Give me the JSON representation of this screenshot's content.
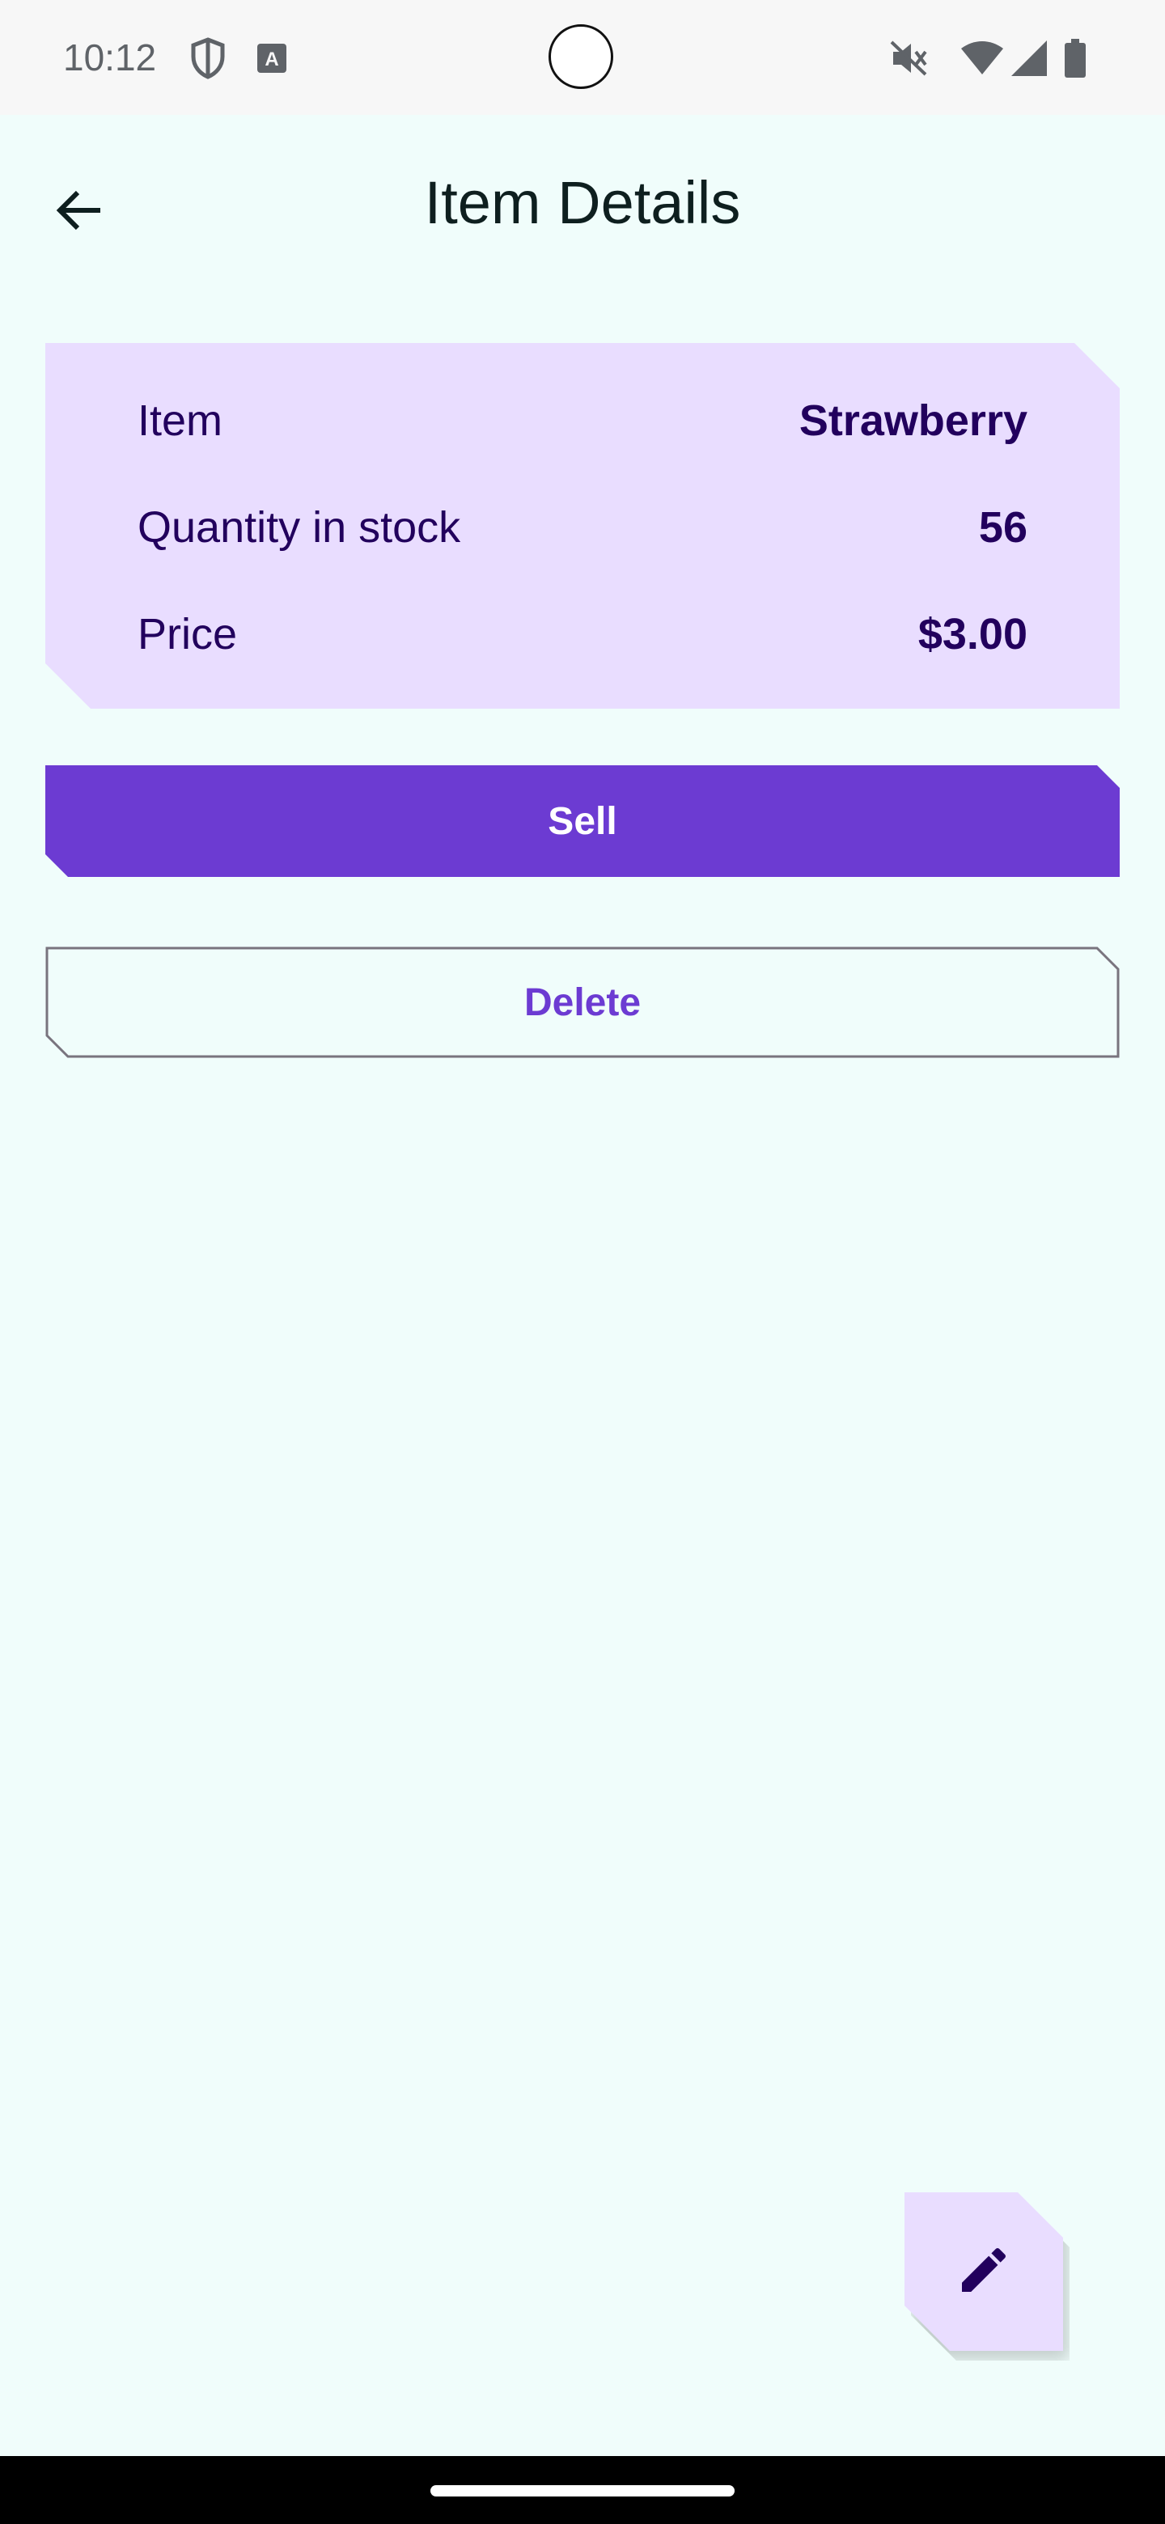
{
  "status_bar": {
    "time": "10:12",
    "icons": [
      "shield-icon",
      "font-a-icon",
      "mute-icon",
      "wifi-icon",
      "signal-icon",
      "battery-icon"
    ]
  },
  "app_bar": {
    "title": "Item Details",
    "back_icon": "arrow-back-icon"
  },
  "item_card": {
    "rows": [
      {
        "label": "Item",
        "value": "Strawberry"
      },
      {
        "label": "Quantity in stock",
        "value": "56"
      },
      {
        "label": "Price",
        "value": "$3.00"
      }
    ]
  },
  "actions": {
    "sell_label": "Sell",
    "delete_label": "Delete"
  },
  "fab": {
    "icon": "edit-pencil-icon"
  },
  "colors": {
    "background": "#F0FDFB",
    "card": "#E9DDFF",
    "primary": "#6C3BD2",
    "on_card": "#22005D"
  }
}
